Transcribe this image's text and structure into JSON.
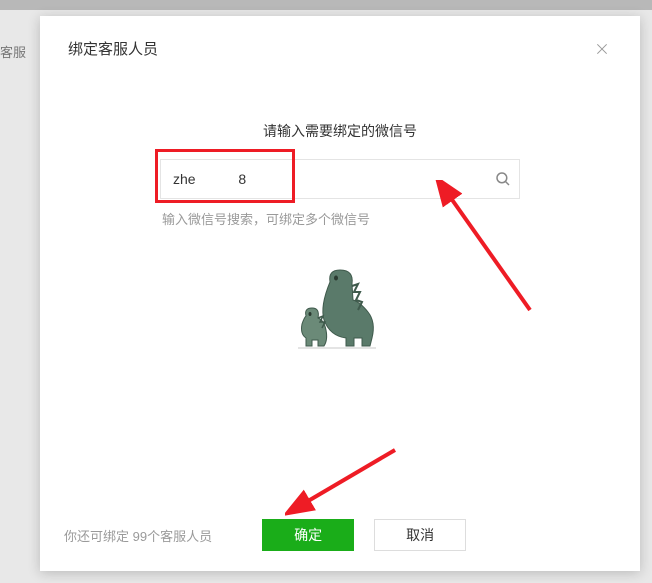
{
  "backdrop": {
    "partial_text": "客服"
  },
  "modal": {
    "title": "绑定客服人员",
    "prompt": "请输入需要绑定的微信号",
    "search": {
      "value": "zhe           8",
      "hint": "输入微信号搜索，可绑定多个微信号"
    },
    "footer": {
      "quota_text": "你还可绑定 99个客服人员",
      "confirm": "确定",
      "cancel": "取消"
    }
  }
}
